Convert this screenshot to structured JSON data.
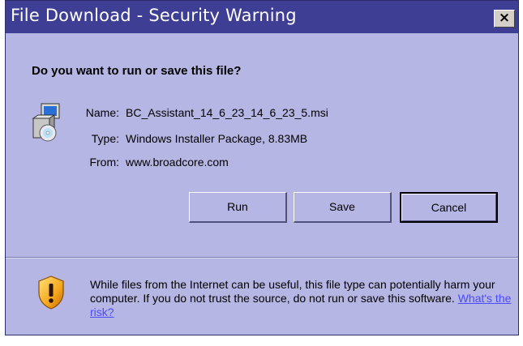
{
  "dialog": {
    "title": "File Download - Security Warning",
    "close_label": "×",
    "question": "Do you want to run or save this file?",
    "file_icon": "installer-package-icon",
    "details": [
      {
        "label": "Name:",
        "value": "BC_Assistant_14_6_23_14_6_23_5.msi"
      },
      {
        "label": "Type:",
        "value": "Windows Installer Package, 8.83MB"
      },
      {
        "label": "From:",
        "value": "www.broadcore.com"
      }
    ],
    "buttons": {
      "run": "Run",
      "save": "Save",
      "cancel": "Cancel"
    },
    "warning": {
      "icon": "shield-warning-icon",
      "text": "While files from the Internet can be useful, this file type can potentially harm your computer. If you do not trust the source, do not run or save this software. ",
      "link": "What's the risk?"
    }
  },
  "colors": {
    "title_bar": "#3e3e94",
    "dialog_background": "#b6b6e4",
    "link": "#4a4aff"
  }
}
